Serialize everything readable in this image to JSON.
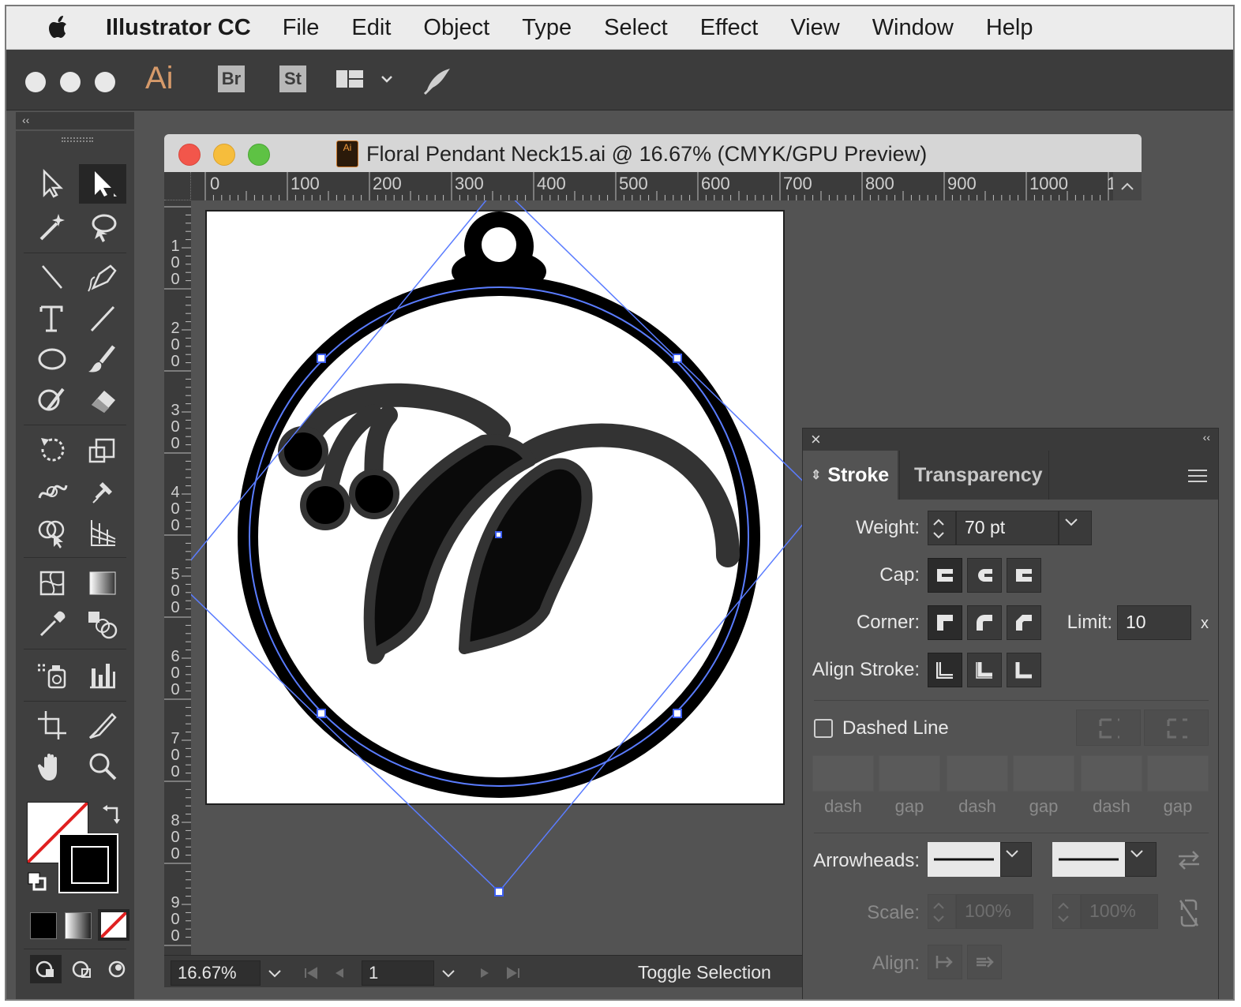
{
  "menubar": {
    "app_name": "Illustrator CC",
    "items": [
      "File",
      "Edit",
      "Object",
      "Type",
      "Select",
      "Effect",
      "View",
      "Window",
      "Help"
    ]
  },
  "appbar": {
    "logo": "Ai",
    "bridge": "Br",
    "stock": "St"
  },
  "tools_panel": {
    "collapse": "‹‹",
    "tools": [
      "selection-tool",
      "direct-selection-tool",
      "magic-wand-tool",
      "lasso-tool",
      "pen-tool",
      "curvature-tool",
      "type-tool",
      "line-segment-tool",
      "ellipse-tool",
      "paintbrush-tool",
      "shaper-tool",
      "eraser-tool",
      "rotate-tool",
      "scale-tool",
      "warp-tool",
      "puppet-warp-tool",
      "shape-builder-tool",
      "perspective-grid-tool",
      "mesh-tool",
      "gradient-tool",
      "eyedropper-tool",
      "blend-tool",
      "symbol-sprayer-tool",
      "column-graph-tool",
      "artboard-tool",
      "slice-tool",
      "hand-tool",
      "zoom-tool"
    ]
  },
  "document": {
    "title": "Floral Pendant Neck15.ai @ 16.67% (CMYK/GPU Preview)",
    "doc_icon": "Ai",
    "ruler_h": [
      "0",
      "100",
      "200",
      "300",
      "400",
      "500",
      "600",
      "700",
      "800",
      "900",
      "1000",
      "1"
    ],
    "ruler_v": [
      "1\n0\n0",
      "2\n0\n0",
      "3\n0\n0",
      "4\n0\n0",
      "5\n0\n0",
      "6\n0\n0",
      "7\n0\n0",
      "8\n0\n0",
      "9\n0\n0"
    ],
    "zoom": "16.67%",
    "artboard_number": "1",
    "status_text": "Toggle Selection"
  },
  "stroke_panel": {
    "collapse": "‹‹",
    "tab_stroke": "Stroke",
    "tab_transparency": "Transparency",
    "weight_label": "Weight:",
    "weight_value": "70 pt",
    "cap_label": "Cap:",
    "corner_label": "Corner:",
    "limit_label": "Limit:",
    "limit_value": "10",
    "limit_unit": "x",
    "align_label": "Align Stroke:",
    "dashed_label": "Dashed Line",
    "dash_gap_labels": [
      "dash",
      "gap",
      "dash",
      "gap",
      "dash",
      "gap"
    ],
    "arrowheads_label": "Arrowheads:",
    "scale_label": "Scale:",
    "scale_start": "100%",
    "scale_end": "100%",
    "align_arrow_label": "Align:"
  },
  "colors": {
    "ui_dark": "#535353",
    "ruler": "#3b3b3b",
    "selection_blue": "#4a6cf0",
    "close_red": "#f2564b",
    "min_yellow": "#f6bd3c",
    "max_green": "#5ec244"
  }
}
